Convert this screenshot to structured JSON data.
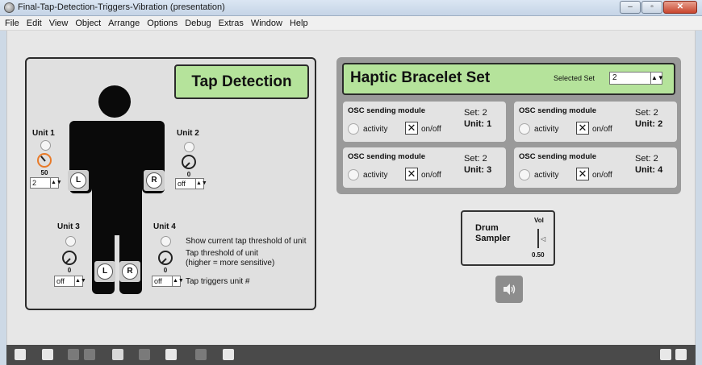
{
  "window": {
    "title": "Final-Tap-Detection-Triggers-Vibration (presentation)",
    "min": "–",
    "max": "▫",
    "close": "✕"
  },
  "menu": [
    "File",
    "Edit",
    "View",
    "Object",
    "Arrange",
    "Options",
    "Debug",
    "Extras",
    "Window",
    "Help"
  ],
  "tap": {
    "title": "Tap Detection",
    "units": [
      {
        "label": "Unit 1",
        "threshold": "50",
        "trigger": "2"
      },
      {
        "label": "Unit 2",
        "threshold": "0",
        "trigger": "off"
      },
      {
        "label": "Unit 3",
        "threshold": "0",
        "trigger": "off"
      },
      {
        "label": "Unit 4",
        "threshold": "0",
        "trigger": "off"
      }
    ],
    "left_marker": "L",
    "right_marker": "R",
    "legend": {
      "led": "Show current tap threshold of unit",
      "dial_line1": "Tap threshold of unit",
      "dial_line2": "(higher = more sensitive)",
      "trigger": "Tap triggers unit #"
    }
  },
  "haptic": {
    "title": "Haptic Bracelet Set",
    "selected_set_label": "Selected Set",
    "selected_set_value": "2",
    "modules": [
      {
        "title": "OSC sending module",
        "set": "Set: 2",
        "unit": "Unit: 1",
        "activity": "activity",
        "onoff": "on/off"
      },
      {
        "title": "OSC sending module",
        "set": "Set: 2",
        "unit": "Unit: 2",
        "activity": "activity",
        "onoff": "on/off"
      },
      {
        "title": "OSC sending module",
        "set": "Set: 2",
        "unit": "Unit: 3",
        "activity": "activity",
        "onoff": "on/off"
      },
      {
        "title": "OSC sending module",
        "set": "Set: 2",
        "unit": "Unit: 4",
        "activity": "activity",
        "onoff": "on/off"
      }
    ]
  },
  "drum": {
    "title_line1": "Drum",
    "title_line2": "Sampler",
    "vol_label": "Vol",
    "vol_value": "0.50"
  },
  "colors": {
    "accent_green": "#b5e39b",
    "dial_orange": "#e87a28"
  }
}
